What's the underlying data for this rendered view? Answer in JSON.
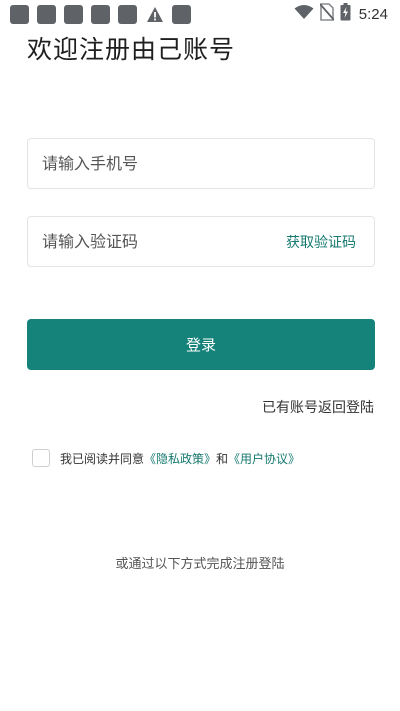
{
  "status_bar": {
    "time": "5:24"
  },
  "title": "欢迎注册由己账号",
  "phone_field": {
    "placeholder": "请输入手机号",
    "value": ""
  },
  "code_field": {
    "placeholder": "请输入验证码",
    "value": "",
    "get_code_label": "获取验证码"
  },
  "login_button": {
    "label": "登录"
  },
  "back_to_login": "已有账号返回登陆",
  "agreement": {
    "prefix": "我已阅读并同意",
    "privacy_link": "《隐私政策》",
    "and": "和",
    "user_agreement_link": "《用户协议》",
    "checked": false
  },
  "other_methods": "或通过以下方式完成注册登陆",
  "colors": {
    "accent": "#15837a",
    "link": "#16796f"
  }
}
